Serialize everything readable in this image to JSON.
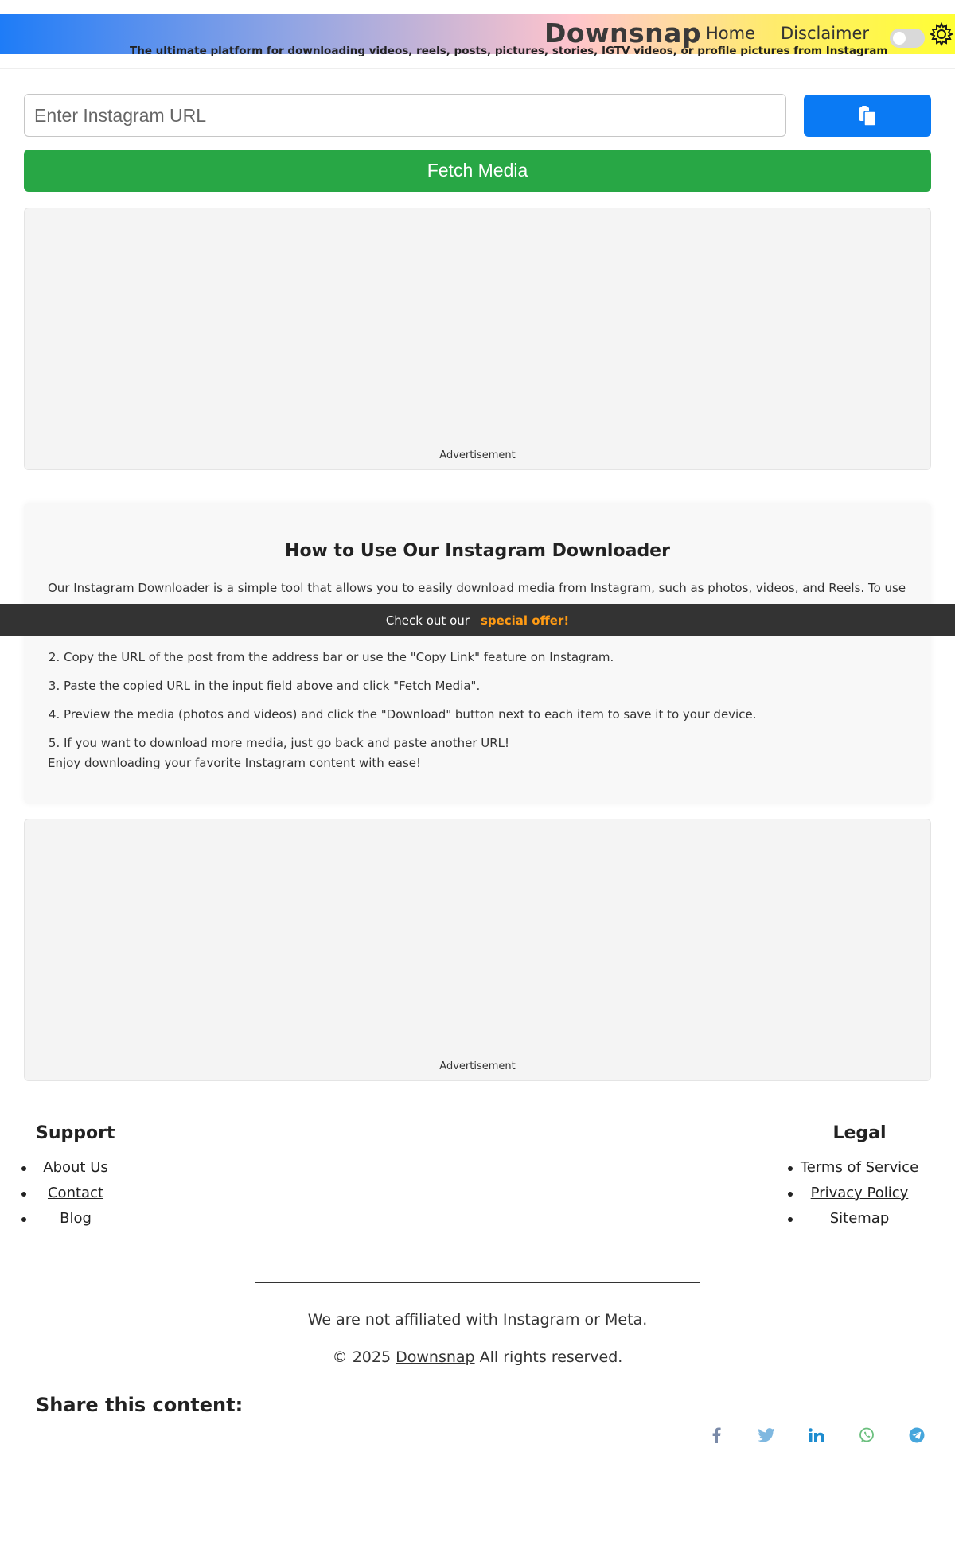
{
  "header": {
    "brand": "Downsnap",
    "tagline": "The ultimate platform for downloading videos, reels, posts, pictures, stories, IGTV videos, or profile pictures from Instagram",
    "nav": {
      "home": "Home",
      "disclaimer": "Disclaimer"
    },
    "theme_toggle": {
      "state": "off"
    },
    "settings_icon": "gear-icon"
  },
  "form": {
    "url_placeholder": "Enter Instagram URL",
    "paste_icon": "clipboard-paste-icon",
    "fetch_label": "Fetch Media"
  },
  "ads": {
    "label_1": "Advertisement",
    "label_2": "Advertisement"
  },
  "howto": {
    "title": "How to Use Our Instagram Downloader",
    "intro": "Our Instagram Downloader is a simple tool that allows you to easily download media from Instagram, such as photos, videos, and Reels. To use it, follow",
    "steps": [
      "Copy the URL of the post from the address bar or use the \"Copy Link\" feature on Instagram.",
      "Paste the copied URL in the input field above and click \"Fetch Media\".",
      "Preview the media (photos and videos) and click the \"Download\" button next to each item to save it to your device.",
      "If you want to download more media, just go back and paste another URL!"
    ],
    "outro": "Enjoy downloading your favorite Instagram content with ease!"
  },
  "offer_bar": {
    "text": "Check out our",
    "link": "special offer!"
  },
  "footer": {
    "support": {
      "title": "Support",
      "links": [
        "About Us",
        "Contact",
        "Blog"
      ]
    },
    "legal": {
      "title": "Legal",
      "links": [
        "Terms of Service",
        "Privacy Policy",
        "Sitemap"
      ]
    },
    "affiliation": "We are not affiliated with Instagram or Meta.",
    "copyright_prefix": "© 2025",
    "copyright_link": "Downsnap",
    "copyright_suffix": "All rights reserved.",
    "share_title": "Share this content:",
    "share_icons": [
      "facebook-icon",
      "twitter-icon",
      "linkedin-icon",
      "whatsapp-icon",
      "telegram-icon"
    ]
  },
  "colors": {
    "primary": "#0a7af4",
    "success": "#28a745",
    "offer_accent": "#ff9b14",
    "offer_bar_bg": "#333333",
    "facebook": "#7a8aa8",
    "twitter": "#7fb8e0",
    "linkedin": "#1e8ccf",
    "whatsapp": "#6bbf7e",
    "telegram": "#46a6dc"
  }
}
